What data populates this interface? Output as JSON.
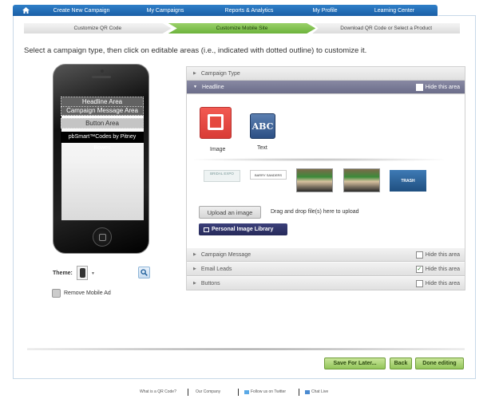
{
  "nav": {
    "items": [
      "Create New Campaign",
      "My Campaigns",
      "Reports & Analytics",
      "My Profile",
      "Learning Center"
    ]
  },
  "steps": [
    "Customize QR Code",
    "Customize Mobile Site",
    "Download QR Code or Select a Product"
  ],
  "instruction": "Select a campaign type, then click on editable areas (i.e., indicated with dotted outline) to customize it.",
  "phone": {
    "headline_area": "Headline Area",
    "message_area": "Campaign Message Area",
    "button_area": "Button Area",
    "brand": "pbSmart™Codes by Pitney Bowes"
  },
  "theme": {
    "label": "Theme:"
  },
  "remove_ad": "Remove Mobile Ad",
  "accordion": {
    "campaign_type": "Campaign Type",
    "headline": "Headline",
    "campaign_message": "Campaign Message",
    "email_leads": "Email Leads",
    "buttons": "Buttons",
    "hide_label": "Hide this area"
  },
  "hide_state": {
    "headline": false,
    "campaign_message": false,
    "email_leads": true,
    "buttons": false
  },
  "headline_types": {
    "image": "Image",
    "text": "Text",
    "abc": "ABC"
  },
  "thumbnails": {
    "logo1": "BRIDAL EXPO",
    "logo2": "BARRY SANDERS",
    "trash": "TRASH"
  },
  "upload": {
    "button": "Upload an image",
    "drag_text": "Drag and drop file(s) here to upload",
    "library": "Personal Image Library"
  },
  "actions": {
    "save_later": "Save For Later...",
    "back": "Back",
    "done": "Done editing"
  },
  "footer": {
    "what_is": "What is a QR Code?",
    "company": "Our Company",
    "twitter": "Follow us on Twitter",
    "chat": "Chat Live"
  },
  "colors": {
    "nav": "#1a5fa6",
    "active_step": "#6cb33c",
    "active_bar": "#6b6d8a",
    "action_btn": "#92c55a"
  }
}
